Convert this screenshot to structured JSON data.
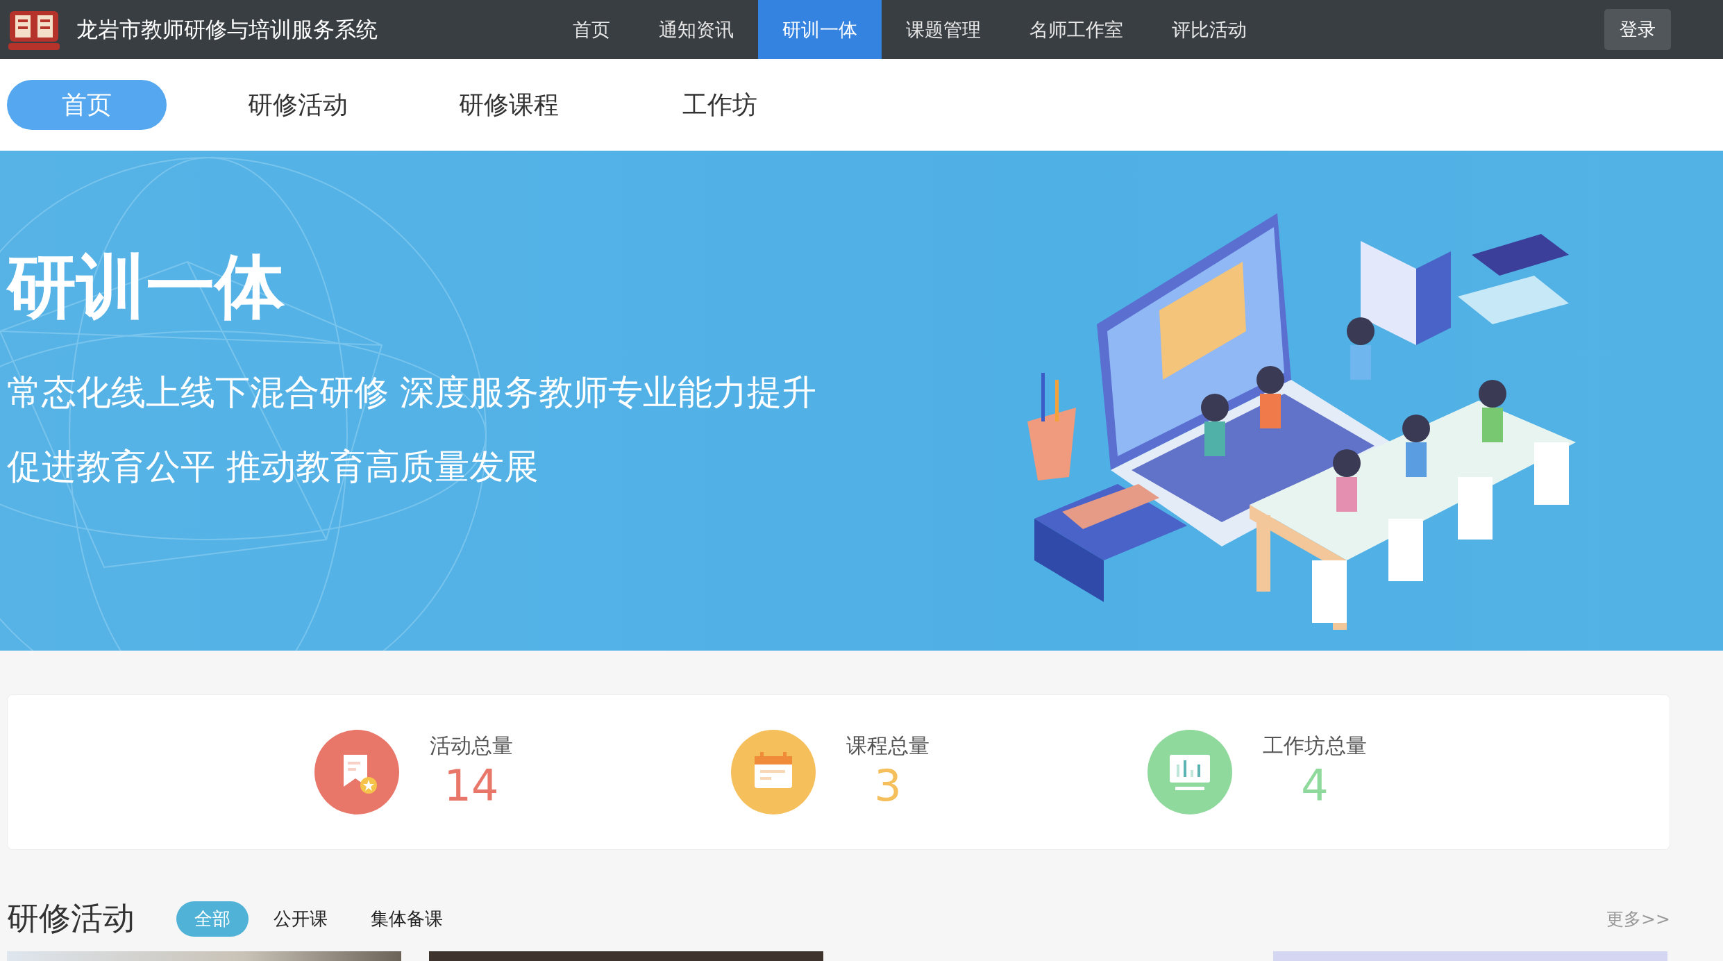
{
  "header": {
    "site_title": "龙岩市教师研修与培训服务系统",
    "nav": [
      {
        "label": "首页",
        "selected": false
      },
      {
        "label": "通知资讯",
        "selected": false
      },
      {
        "label": "研训一体",
        "selected": true
      },
      {
        "label": "课题管理",
        "selected": false
      },
      {
        "label": "名师工作室",
        "selected": false
      },
      {
        "label": "评比活动",
        "selected": false
      }
    ],
    "login_button": "登录"
  },
  "subnav": [
    {
      "label": "首页",
      "selected": true
    },
    {
      "label": "研修活动",
      "selected": false
    },
    {
      "label": "研修课程",
      "selected": false
    },
    {
      "label": "工作坊",
      "selected": false
    }
  ],
  "banner": {
    "title": "研训一体",
    "lines": [
      "常态化线上线下混合研修 深度服务教师专业能力提升",
      "促进教育公平 推动教育高质量发展"
    ]
  },
  "stats": [
    {
      "kind": "activity",
      "label": "活动总量",
      "value": "14",
      "color": "#e8776a"
    },
    {
      "kind": "course",
      "label": "课程总量",
      "value": "3",
      "color": "#f5bf5b"
    },
    {
      "kind": "workshop",
      "label": "工作坊总量",
      "value": "4",
      "color": "#8fd99c"
    }
  ],
  "activities": {
    "title": "研修活动",
    "filters": [
      {
        "label": "全部",
        "selected": true
      },
      {
        "label": "公开课",
        "selected": false
      },
      {
        "label": "集体备课",
        "selected": false
      }
    ],
    "more": "更多>>"
  }
}
